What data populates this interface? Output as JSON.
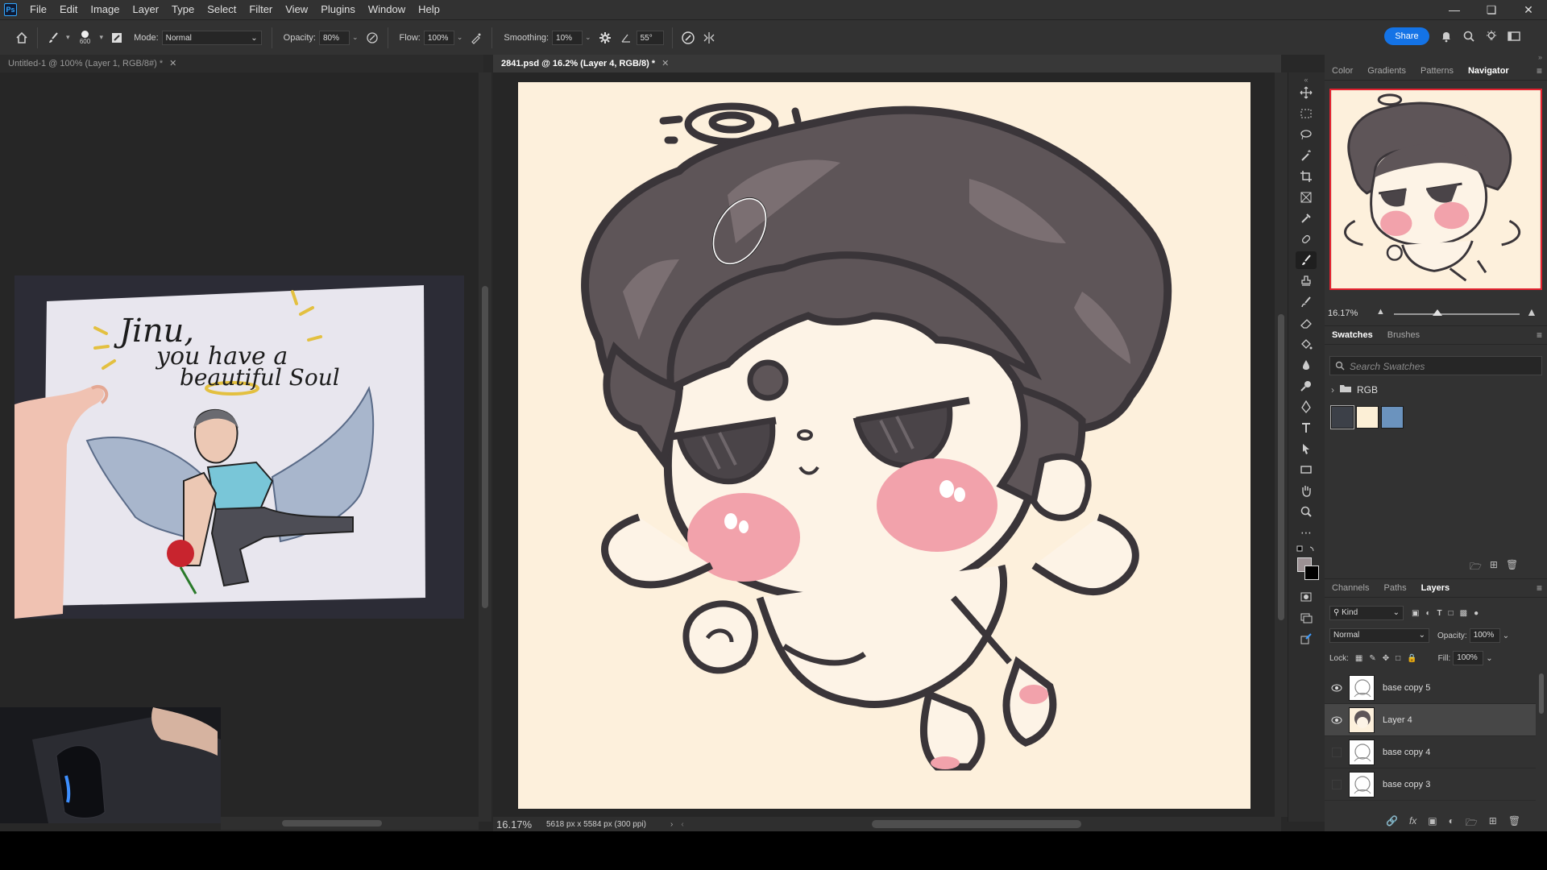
{
  "menubar": {
    "logo": "Ps",
    "items": [
      "File",
      "Edit",
      "Image",
      "Layer",
      "Type",
      "Select",
      "Filter",
      "View",
      "Plugins",
      "Window",
      "Help"
    ]
  },
  "options": {
    "brush_size": "600",
    "mode_label": "Mode:",
    "mode_value": "Normal",
    "opacity_label": "Opacity:",
    "opacity_value": "80%",
    "flow_label": "Flow:",
    "flow_value": "100%",
    "smoothing_label": "Smoothing:",
    "smoothing_value": "10%",
    "angle_value": "55°",
    "share_label": "Share"
  },
  "tabs": {
    "doc1": "Untitled-1 @ 100% (Layer 1, RGB/8#) *",
    "doc2": "2841.psd @ 16.2% (Layer 4, RGB/8) *"
  },
  "reference_photo": {
    "line1": "Jinu,",
    "line2": "you have a",
    "line3": "beautiful Soul"
  },
  "status": {
    "zoom": "16.17%",
    "doc_info": "5618 px x 5584 px (300 ppi)"
  },
  "navigator": {
    "tabs": [
      "Color",
      "Gradients",
      "Patterns",
      "Navigator"
    ],
    "active_tab": "Navigator",
    "zoom": "16.17%"
  },
  "swatches": {
    "tabs": [
      "Swatches",
      "Brushes"
    ],
    "search_placeholder": "Search Swatches",
    "group_name": "RGB",
    "colors": [
      "#3c4048",
      "#fcefd6",
      "#6b93be"
    ]
  },
  "layers_panel": {
    "tabs": [
      "Channels",
      "Paths",
      "Layers"
    ],
    "filter_kind": "Kind",
    "blend_mode": "Normal",
    "opacity_label": "Opacity:",
    "opacity_value": "100%",
    "lock_label": "Lock:",
    "fill_label": "Fill:",
    "fill_value": "100%",
    "layers": [
      {
        "name": "base copy 5",
        "visible": true,
        "selected": false
      },
      {
        "name": "Layer 4",
        "visible": true,
        "selected": true
      },
      {
        "name": "base copy 4",
        "visible": false,
        "selected": false
      },
      {
        "name": "base copy 3",
        "visible": false,
        "selected": false
      }
    ]
  },
  "colors": {
    "accent": "#1473e6",
    "canvas_bg": "#fdf0dc",
    "hair": "#5e5558",
    "outline": "#3a3539",
    "blush": "#f2a2ab"
  }
}
